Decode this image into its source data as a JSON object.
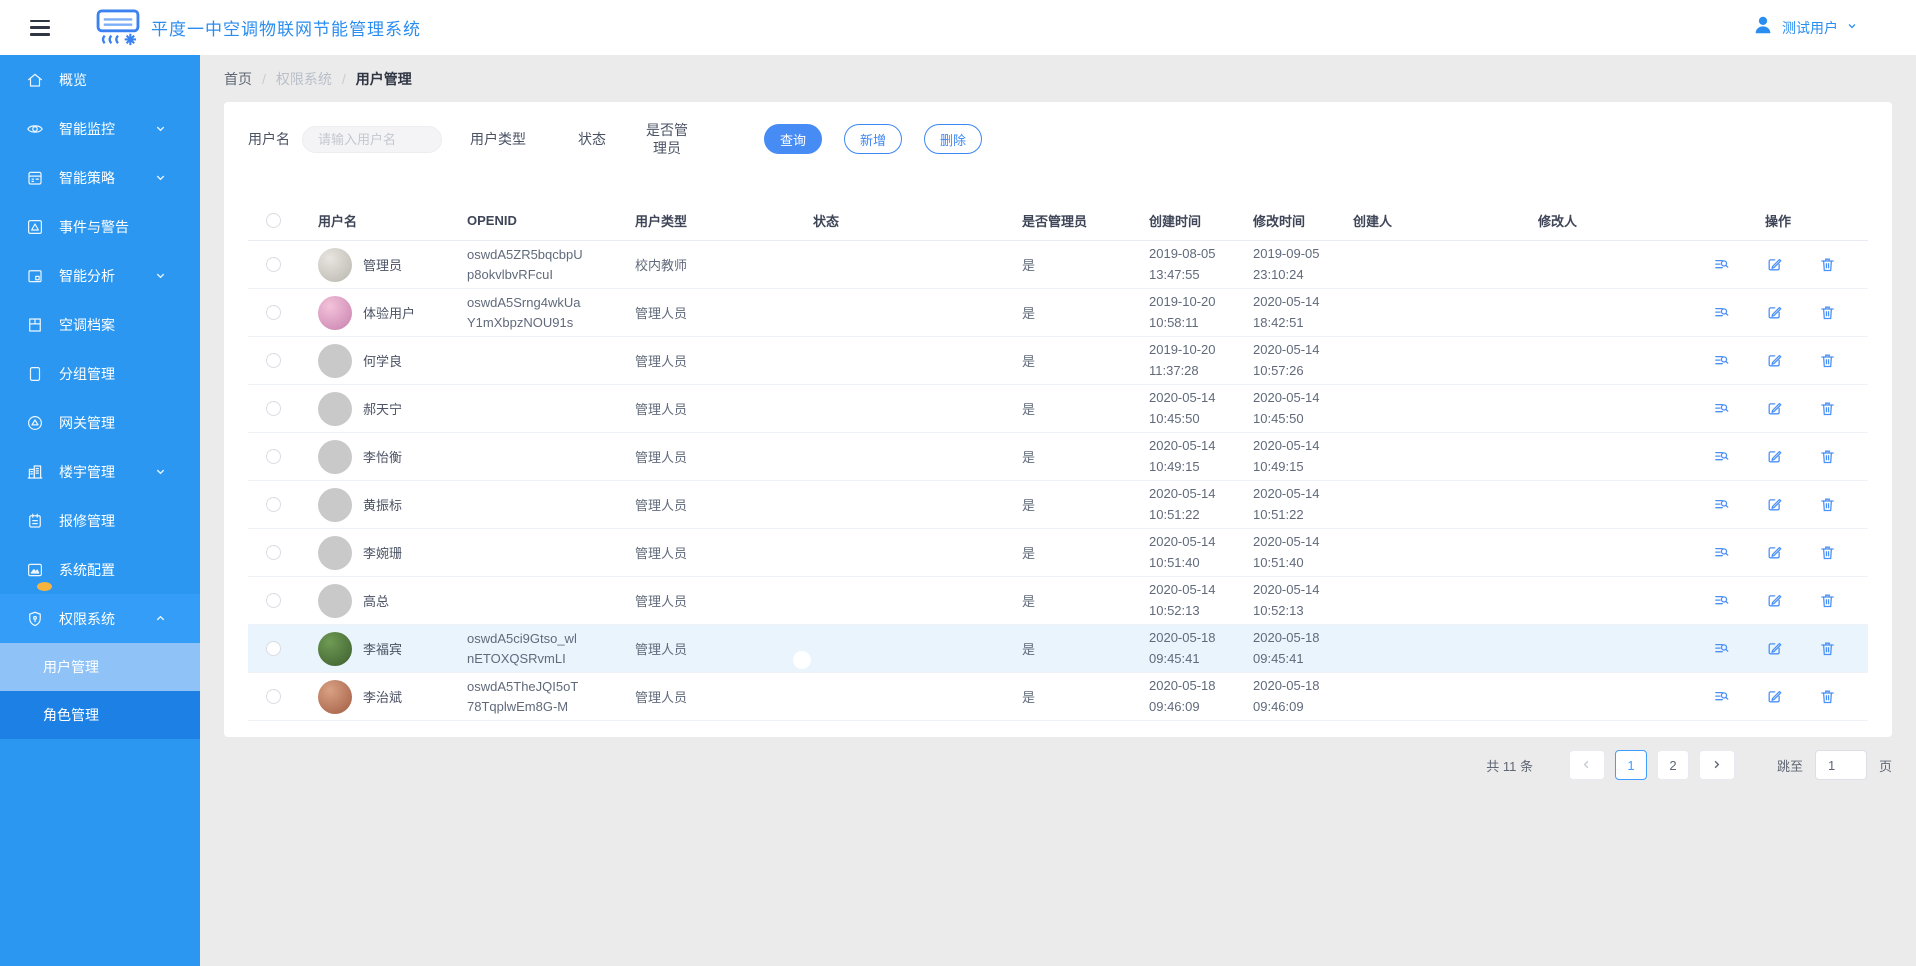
{
  "header": {
    "title": "平度一中空调物联网节能管理系统",
    "user": {
      "name": "测试用户"
    }
  },
  "sidebar": {
    "items": [
      {
        "label": "概览",
        "icon": "home"
      },
      {
        "label": "智能监控",
        "icon": "eye",
        "chevron": "down"
      },
      {
        "label": "智能策略",
        "icon": "strategy",
        "chevron": "down"
      },
      {
        "label": "事件与警告",
        "icon": "alert"
      },
      {
        "label": "智能分析",
        "icon": "analysis",
        "chevron": "down"
      },
      {
        "label": "空调档案",
        "icon": "archive"
      },
      {
        "label": "分组管理",
        "icon": "group"
      },
      {
        "label": "网关管理",
        "icon": "gateway"
      },
      {
        "label": "楼宇管理",
        "icon": "building",
        "chevron": "down"
      },
      {
        "label": "报修管理",
        "icon": "repair"
      },
      {
        "label": "系统配置",
        "icon": "system",
        "badge": true
      },
      {
        "label": "权限系统",
        "icon": "shield",
        "chevron": "up",
        "active_section": true,
        "children": [
          {
            "label": "用户管理",
            "active": true
          },
          {
            "label": "角色管理"
          }
        ]
      }
    ]
  },
  "breadcrumb": {
    "items": [
      "首页",
      "权限系统",
      "用户管理"
    ]
  },
  "filters": {
    "username_label": "用户名",
    "username_placeholder": "请输入用户名",
    "type_label": "用户类型",
    "status_label": "状态",
    "admin_label": "是否管理员",
    "query_label": "查询",
    "add_label": "新增",
    "delete_label": "删除"
  },
  "table": {
    "columns": [
      "用户名",
      "OPENID",
      "用户类型",
      "状态",
      "是否管理员",
      "创建时间",
      "修改时间",
      "创建人",
      "修改人",
      "操作"
    ],
    "actions": [
      "view",
      "edit",
      "delete"
    ],
    "rows": [
      {
        "name": "管理员",
        "openid": "oswdA5ZR5bqcbpUp8okvlbvRFcuI",
        "type": "校内教师",
        "status": true,
        "admin": "是",
        "created": {
          "date": "2019-08-05",
          "time": "13:47:55"
        },
        "modified": {
          "date": "2019-09-05",
          "time": "23:10:24"
        },
        "creator": "",
        "modifier": "",
        "avatar": {
          "from": "#e8e5e0",
          "to": "#b9b5ae"
        },
        "photo": true,
        "highlight": false
      },
      {
        "name": "体验用户",
        "openid": "oswdA5Srng4wkUaY1mXbpzNOU91s",
        "type": "管理人员",
        "status": true,
        "admin": "是",
        "created": {
          "date": "2019-10-20",
          "time": "10:58:11"
        },
        "modified": {
          "date": "2020-05-14",
          "time": "18:42:51"
        },
        "creator": "",
        "modifier": "",
        "avatar": {
          "from": "#f3c3da",
          "to": "#c77fae"
        },
        "photo": true,
        "highlight": false
      },
      {
        "name": "何学良",
        "openid": "",
        "type": "管理人员",
        "status": true,
        "admin": "是",
        "created": {
          "date": "2019-10-20",
          "time": "11:37:28"
        },
        "modified": {
          "date": "2020-05-14",
          "time": "10:57:26"
        },
        "creator": "",
        "modifier": "",
        "avatar": {
          "from": "#c9c9c9",
          "to": "#c9c9c9"
        },
        "photo": false,
        "highlight": false
      },
      {
        "name": "郝天宁",
        "openid": "",
        "type": "管理人员",
        "status": true,
        "admin": "是",
        "created": {
          "date": "2020-05-14",
          "time": "10:45:50"
        },
        "modified": {
          "date": "2020-05-14",
          "time": "10:45:50"
        },
        "creator": "",
        "modifier": "",
        "avatar": {
          "from": "#c9c9c9",
          "to": "#c9c9c9"
        },
        "photo": false,
        "highlight": false
      },
      {
        "name": "李怡衡",
        "openid": "",
        "type": "管理人员",
        "status": true,
        "admin": "是",
        "created": {
          "date": "2020-05-14",
          "time": "10:49:15"
        },
        "modified": {
          "date": "2020-05-14",
          "time": "10:49:15"
        },
        "creator": "",
        "modifier": "",
        "avatar": {
          "from": "#c9c9c9",
          "to": "#c9c9c9"
        },
        "photo": false,
        "highlight": false
      },
      {
        "name": "黄振标",
        "openid": "",
        "type": "管理人员",
        "status": true,
        "admin": "是",
        "created": {
          "date": "2020-05-14",
          "time": "10:51:22"
        },
        "modified": {
          "date": "2020-05-14",
          "time": "10:51:22"
        },
        "creator": "",
        "modifier": "",
        "avatar": {
          "from": "#c9c9c9",
          "to": "#c9c9c9"
        },
        "photo": false,
        "highlight": false
      },
      {
        "name": "李婉珊",
        "openid": "",
        "type": "管理人员",
        "status": true,
        "admin": "是",
        "created": {
          "date": "2020-05-14",
          "time": "10:51:40"
        },
        "modified": {
          "date": "2020-05-14",
          "time": "10:51:40"
        },
        "creator": "",
        "modifier": "",
        "avatar": {
          "from": "#c9c9c9",
          "to": "#c9c9c9"
        },
        "photo": false,
        "highlight": false
      },
      {
        "name": "高总",
        "openid": "",
        "type": "管理人员",
        "status": true,
        "admin": "是",
        "created": {
          "date": "2020-05-14",
          "time": "10:52:13"
        },
        "modified": {
          "date": "2020-05-14",
          "time": "10:52:13"
        },
        "creator": "",
        "modifier": "",
        "avatar": {
          "from": "#c9c9c9",
          "to": "#c9c9c9"
        },
        "photo": false,
        "highlight": false
      },
      {
        "name": "李福宾",
        "openid": "oswdA5ci9Gtso_wlnETOXQSRvmLI",
        "type": "管理人员",
        "status": true,
        "admin": "是",
        "created": {
          "date": "2020-05-18",
          "time": "09:45:41"
        },
        "modified": {
          "date": "2020-05-18",
          "time": "09:45:41"
        },
        "creator": "",
        "modifier": "",
        "avatar": {
          "from": "#6f9a54",
          "to": "#3c5e2e"
        },
        "photo": true,
        "highlight": true
      },
      {
        "name": "李治斌",
        "openid": "oswdA5TheJQI5oT78TqplwEm8G-M",
        "type": "管理人员",
        "status": true,
        "admin": "是",
        "created": {
          "date": "2020-05-18",
          "time": "09:46:09"
        },
        "modified": {
          "date": "2020-05-18",
          "time": "09:46:09"
        },
        "creator": "",
        "modifier": "",
        "avatar": {
          "from": "#d9a184",
          "to": "#a15c43"
        },
        "photo": true,
        "highlight": false
      }
    ]
  },
  "pagination": {
    "total_label": "共 11 条",
    "pages": [
      "1",
      "2"
    ],
    "current": "1",
    "jump_label": "跳至",
    "jump_value": "1",
    "page_suffix": "页"
  },
  "colors": {
    "sidebar": "#2b97f1",
    "sidebar_section_active": "#339df7",
    "submenu": "#1c80e4",
    "submenu_active": "#8fc3f7",
    "accent_blue": "#2b8df0",
    "primary_button": "#478bf5",
    "toggle_on": "#2487f0",
    "action_icon": "#4a90f7",
    "row_highlight": "#e9f4fd",
    "badge_yellow": "#f6b33d"
  }
}
